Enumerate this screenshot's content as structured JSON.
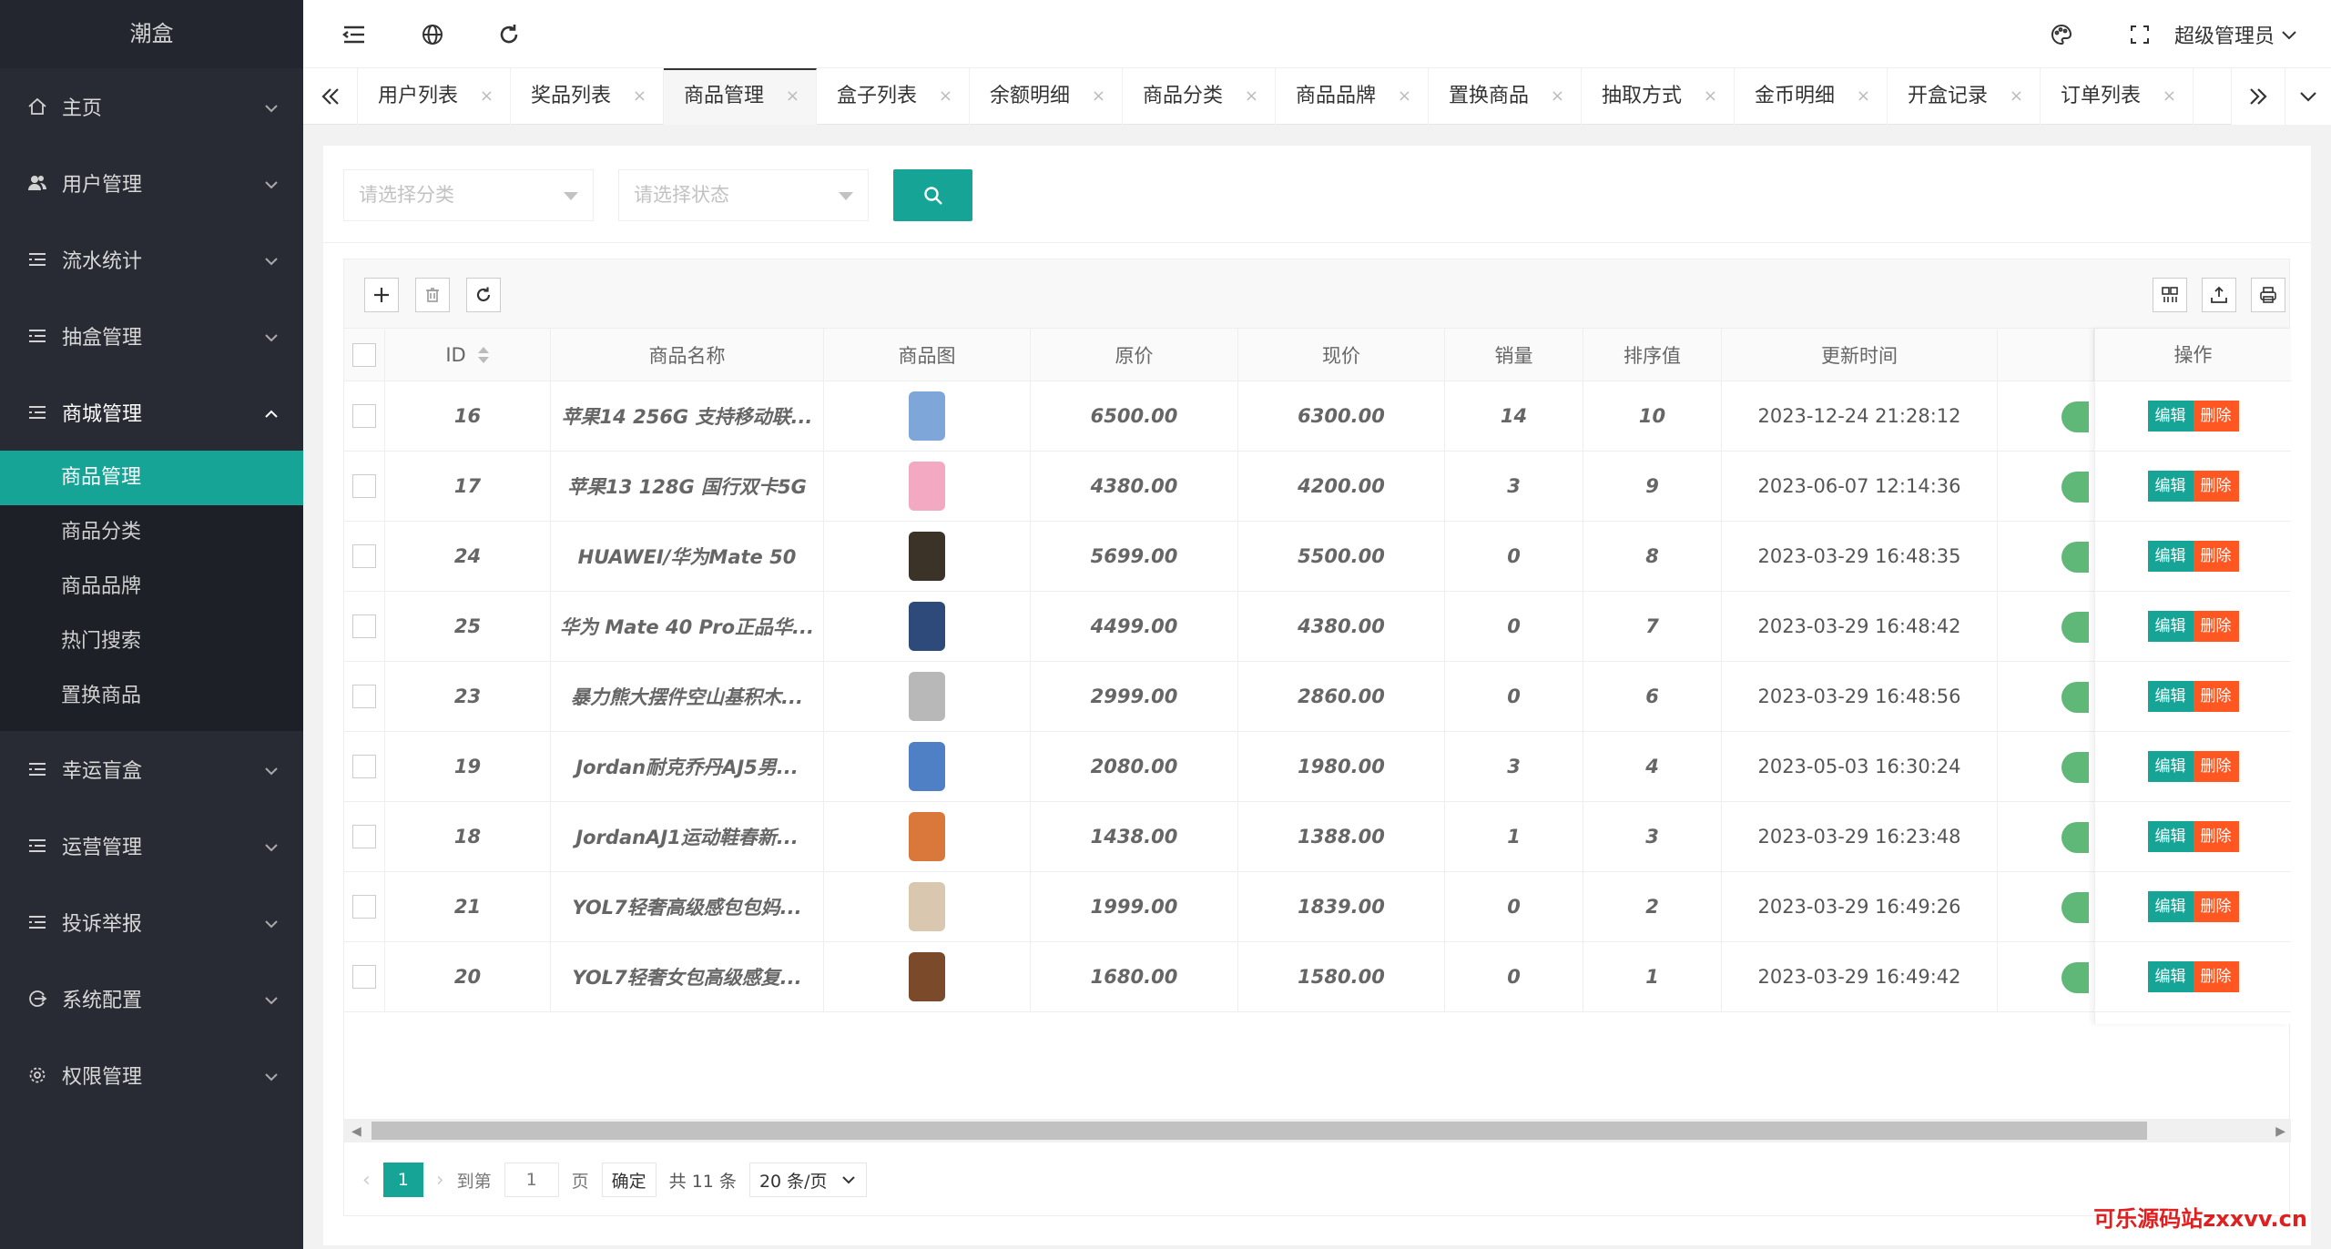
{
  "app": {
    "title": "潮盒"
  },
  "sidebar": {
    "menus": [
      {
        "label": "主页",
        "icon": "home-icon"
      },
      {
        "label": "用户管理",
        "icon": "users-icon"
      },
      {
        "label": "流水统计",
        "icon": "list-icon"
      },
      {
        "label": "抽盒管理",
        "icon": "list-icon"
      },
      {
        "label": "商城管理",
        "icon": "list-icon",
        "open": true,
        "children": [
          "商品管理",
          "商品分类",
          "商品品牌",
          "热门搜索",
          "置换商品"
        ]
      },
      {
        "label": "幸运盲盒",
        "icon": "list-icon"
      },
      {
        "label": "运营管理",
        "icon": "list-icon"
      },
      {
        "label": "投诉举报",
        "icon": "list-icon"
      },
      {
        "label": "系统配置",
        "icon": "config-icon"
      },
      {
        "label": "权限管理",
        "icon": "gear-icon"
      }
    ],
    "active_child": "商品管理"
  },
  "header": {
    "admin_name": "超级管理员"
  },
  "tabs": [
    "用户列表",
    "奖品列表",
    "商品管理",
    "盒子列表",
    "余额明细",
    "商品分类",
    "商品品牌",
    "置换商品",
    "抽取方式",
    "金币明细",
    "开盒记录",
    "订单列表"
  ],
  "active_tab": "商品管理",
  "search": {
    "category_placeholder": "请选择分类",
    "status_placeholder": "请选择状态"
  },
  "table": {
    "headers": {
      "id": "ID",
      "name": "商品名称",
      "image": "商品图",
      "orig_price": "原价",
      "price": "现价",
      "sales": "销量",
      "sort": "排序值",
      "updated": "更新时间",
      "ops": "操作"
    },
    "rows": [
      {
        "id": "16",
        "name": "苹果14 256G 支持移动联...",
        "orig_price": "6500.00",
        "price": "6300.00",
        "sales": "14",
        "sort": "10",
        "updated": "2023-12-24 21:28:12",
        "img_color": "#7fa6d8"
      },
      {
        "id": "17",
        "name": "苹果13 128G 国行双卡5G",
        "orig_price": "4380.00",
        "price": "4200.00",
        "sales": "3",
        "sort": "9",
        "updated": "2023-06-07 12:14:36",
        "img_color": "#f4a9c2"
      },
      {
        "id": "24",
        "name": "HUAWEI/华为Mate 50",
        "orig_price": "5699.00",
        "price": "5500.00",
        "sales": "0",
        "sort": "8",
        "updated": "2023-03-29 16:48:35",
        "img_color": "#3b3328"
      },
      {
        "id": "25",
        "name": "华为 Mate 40 Pro正品华...",
        "orig_price": "4499.00",
        "price": "4380.00",
        "sales": "0",
        "sort": "7",
        "updated": "2023-03-29 16:48:42",
        "img_color": "#2e4a7a"
      },
      {
        "id": "23",
        "name": "暴力熊大摆件空山基积木...",
        "orig_price": "2999.00",
        "price": "2860.00",
        "sales": "0",
        "sort": "6",
        "updated": "2023-03-29 16:48:56",
        "img_color": "#b8b8b8"
      },
      {
        "id": "19",
        "name": "Jordan耐克乔丹AJ5男...",
        "orig_price": "2080.00",
        "price": "1980.00",
        "sales": "3",
        "sort": "4",
        "updated": "2023-05-03 16:30:24",
        "img_color": "#4f7fc4"
      },
      {
        "id": "18",
        "name": "JordanAJ1运动鞋春新...",
        "orig_price": "1438.00",
        "price": "1388.00",
        "sales": "1",
        "sort": "3",
        "updated": "2023-03-29 16:23:48",
        "img_color": "#d9783a"
      },
      {
        "id": "21",
        "name": "YOL7轻奢高级感包包妈...",
        "orig_price": "1999.00",
        "price": "1839.00",
        "sales": "0",
        "sort": "2",
        "updated": "2023-03-29 16:49:26",
        "img_color": "#d9c7b0"
      },
      {
        "id": "20",
        "name": "YOL7轻奢女包高级感复...",
        "orig_price": "1680.00",
        "price": "1580.00",
        "sales": "0",
        "sort": "1",
        "updated": "2023-03-29 16:49:42",
        "img_color": "#7a4a2a"
      }
    ],
    "edit_label": "编辑",
    "delete_label": "删除"
  },
  "pager": {
    "current": "1",
    "goto_label": "到第",
    "goto_value": "1",
    "page_unit": "页",
    "confirm_label": "确定",
    "total_label": "共 11 条",
    "page_size": "20 条/页"
  },
  "watermark": "可乐源码站zxxvv.cn",
  "colors": {
    "primary": "#16a497",
    "danger": "#ff5722",
    "sidebar": "#282b33",
    "status": "#5fb878"
  }
}
